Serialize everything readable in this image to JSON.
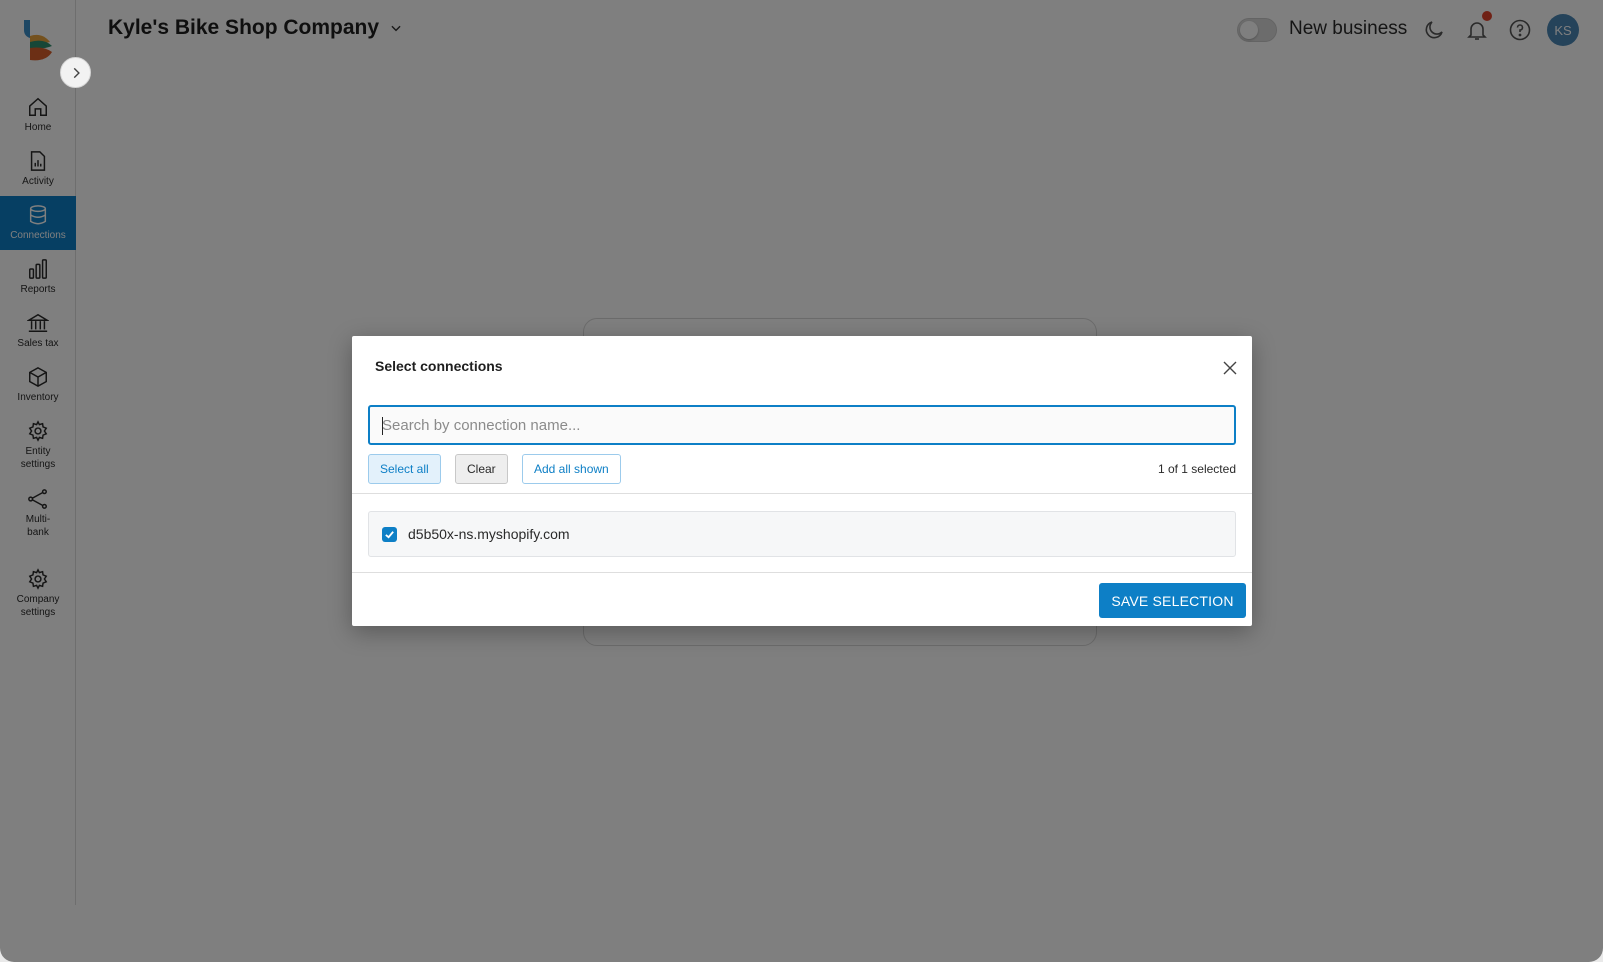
{
  "header": {
    "company_name": "Kyle's Bike Shop Company",
    "toggle_label": "New business",
    "avatar_initials": "KS"
  },
  "sidebar": {
    "items": [
      {
        "label": "Home",
        "icon": "home-icon"
      },
      {
        "label": "Activity",
        "icon": "activity-icon"
      },
      {
        "label": "Connections",
        "icon": "database-icon",
        "active": true
      },
      {
        "label": "Reports",
        "icon": "bar-chart-icon"
      },
      {
        "label": "Sales tax",
        "icon": "bank-icon"
      },
      {
        "label": "Inventory",
        "icon": "box-icon"
      },
      {
        "label": "Entity settings",
        "icon": "gear-icon"
      },
      {
        "label": "Multi-bank",
        "icon": "share-icon"
      },
      {
        "label": "Company settings",
        "icon": "gear-icon"
      }
    ]
  },
  "modal": {
    "title": "Select connections",
    "search_placeholder": "Search by connection name...",
    "select_all_label": "Select all",
    "clear_label": "Clear",
    "add_all_shown_label": "Add all shown",
    "selected_count": "1 of 1 selected",
    "connections": [
      {
        "name": "d5b50x-ns.myshopify.com",
        "checked": true
      }
    ],
    "save_label": "SAVE SELECTION"
  },
  "colors": {
    "accent": "#0d7fc6",
    "notification_dot": "#e0432b",
    "avatar": "#4b86b4"
  }
}
